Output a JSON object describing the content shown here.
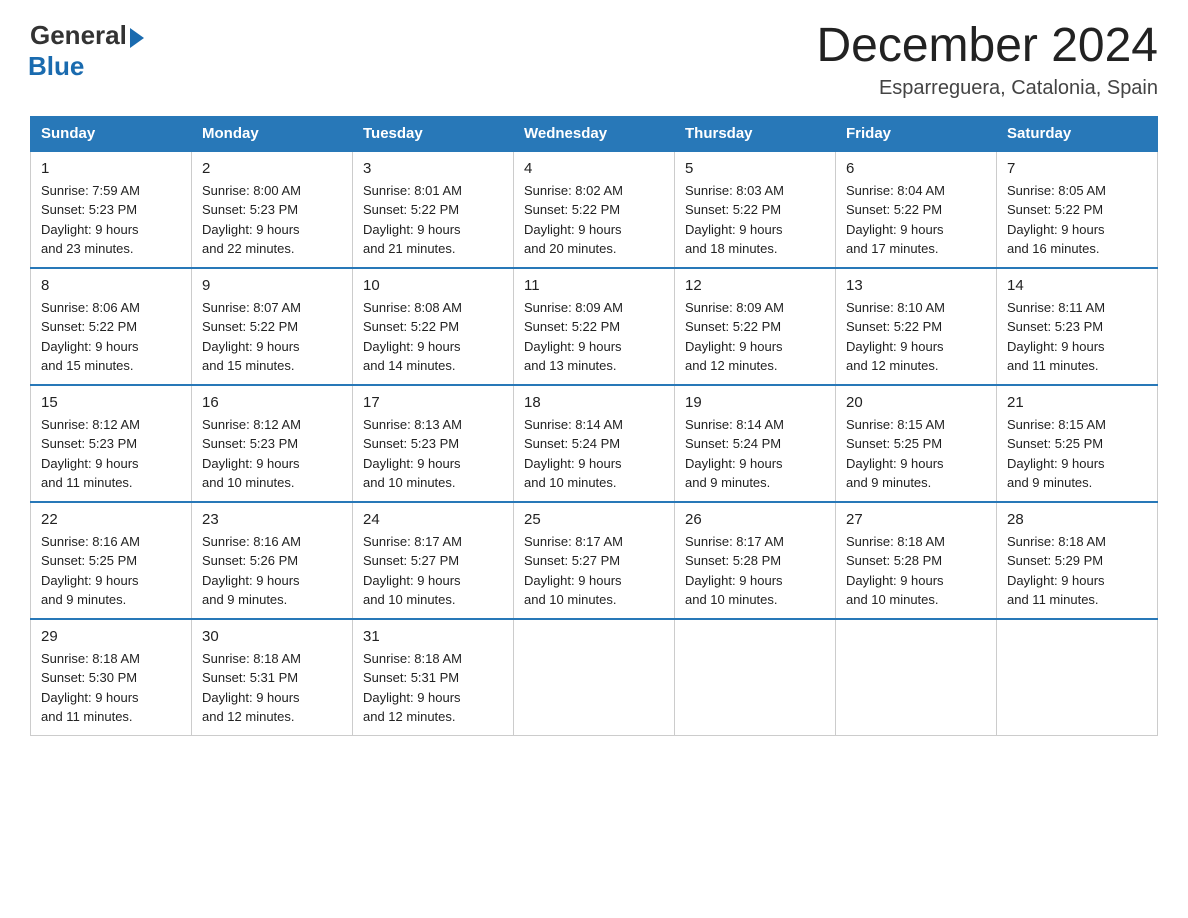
{
  "logo": {
    "general": "General",
    "blue": "Blue"
  },
  "title": "December 2024",
  "location": "Esparreguera, Catalonia, Spain",
  "days_of_week": [
    "Sunday",
    "Monday",
    "Tuesday",
    "Wednesday",
    "Thursday",
    "Friday",
    "Saturday"
  ],
  "weeks": [
    [
      {
        "day": "1",
        "sunrise": "7:59 AM",
        "sunset": "5:23 PM",
        "daylight": "9 hours and 23 minutes."
      },
      {
        "day": "2",
        "sunrise": "8:00 AM",
        "sunset": "5:23 PM",
        "daylight": "9 hours and 22 minutes."
      },
      {
        "day": "3",
        "sunrise": "8:01 AM",
        "sunset": "5:22 PM",
        "daylight": "9 hours and 21 minutes."
      },
      {
        "day": "4",
        "sunrise": "8:02 AM",
        "sunset": "5:22 PM",
        "daylight": "9 hours and 20 minutes."
      },
      {
        "day": "5",
        "sunrise": "8:03 AM",
        "sunset": "5:22 PM",
        "daylight": "9 hours and 18 minutes."
      },
      {
        "day": "6",
        "sunrise": "8:04 AM",
        "sunset": "5:22 PM",
        "daylight": "9 hours and 17 minutes."
      },
      {
        "day": "7",
        "sunrise": "8:05 AM",
        "sunset": "5:22 PM",
        "daylight": "9 hours and 16 minutes."
      }
    ],
    [
      {
        "day": "8",
        "sunrise": "8:06 AM",
        "sunset": "5:22 PM",
        "daylight": "9 hours and 15 minutes."
      },
      {
        "day": "9",
        "sunrise": "8:07 AM",
        "sunset": "5:22 PM",
        "daylight": "9 hours and 15 minutes."
      },
      {
        "day": "10",
        "sunrise": "8:08 AM",
        "sunset": "5:22 PM",
        "daylight": "9 hours and 14 minutes."
      },
      {
        "day": "11",
        "sunrise": "8:09 AM",
        "sunset": "5:22 PM",
        "daylight": "9 hours and 13 minutes."
      },
      {
        "day": "12",
        "sunrise": "8:09 AM",
        "sunset": "5:22 PM",
        "daylight": "9 hours and 12 minutes."
      },
      {
        "day": "13",
        "sunrise": "8:10 AM",
        "sunset": "5:22 PM",
        "daylight": "9 hours and 12 minutes."
      },
      {
        "day": "14",
        "sunrise": "8:11 AM",
        "sunset": "5:23 PM",
        "daylight": "9 hours and 11 minutes."
      }
    ],
    [
      {
        "day": "15",
        "sunrise": "8:12 AM",
        "sunset": "5:23 PM",
        "daylight": "9 hours and 11 minutes."
      },
      {
        "day": "16",
        "sunrise": "8:12 AM",
        "sunset": "5:23 PM",
        "daylight": "9 hours and 10 minutes."
      },
      {
        "day": "17",
        "sunrise": "8:13 AM",
        "sunset": "5:23 PM",
        "daylight": "9 hours and 10 minutes."
      },
      {
        "day": "18",
        "sunrise": "8:14 AM",
        "sunset": "5:24 PM",
        "daylight": "9 hours and 10 minutes."
      },
      {
        "day": "19",
        "sunrise": "8:14 AM",
        "sunset": "5:24 PM",
        "daylight": "9 hours and 9 minutes."
      },
      {
        "day": "20",
        "sunrise": "8:15 AM",
        "sunset": "5:25 PM",
        "daylight": "9 hours and 9 minutes."
      },
      {
        "day": "21",
        "sunrise": "8:15 AM",
        "sunset": "5:25 PM",
        "daylight": "9 hours and 9 minutes."
      }
    ],
    [
      {
        "day": "22",
        "sunrise": "8:16 AM",
        "sunset": "5:25 PM",
        "daylight": "9 hours and 9 minutes."
      },
      {
        "day": "23",
        "sunrise": "8:16 AM",
        "sunset": "5:26 PM",
        "daylight": "9 hours and 9 minutes."
      },
      {
        "day": "24",
        "sunrise": "8:17 AM",
        "sunset": "5:27 PM",
        "daylight": "9 hours and 10 minutes."
      },
      {
        "day": "25",
        "sunrise": "8:17 AM",
        "sunset": "5:27 PM",
        "daylight": "9 hours and 10 minutes."
      },
      {
        "day": "26",
        "sunrise": "8:17 AM",
        "sunset": "5:28 PM",
        "daylight": "9 hours and 10 minutes."
      },
      {
        "day": "27",
        "sunrise": "8:18 AM",
        "sunset": "5:28 PM",
        "daylight": "9 hours and 10 minutes."
      },
      {
        "day": "28",
        "sunrise": "8:18 AM",
        "sunset": "5:29 PM",
        "daylight": "9 hours and 11 minutes."
      }
    ],
    [
      {
        "day": "29",
        "sunrise": "8:18 AM",
        "sunset": "5:30 PM",
        "daylight": "9 hours and 11 minutes."
      },
      {
        "day": "30",
        "sunrise": "8:18 AM",
        "sunset": "5:31 PM",
        "daylight": "9 hours and 12 minutes."
      },
      {
        "day": "31",
        "sunrise": "8:18 AM",
        "sunset": "5:31 PM",
        "daylight": "9 hours and 12 minutes."
      },
      null,
      null,
      null,
      null
    ]
  ]
}
